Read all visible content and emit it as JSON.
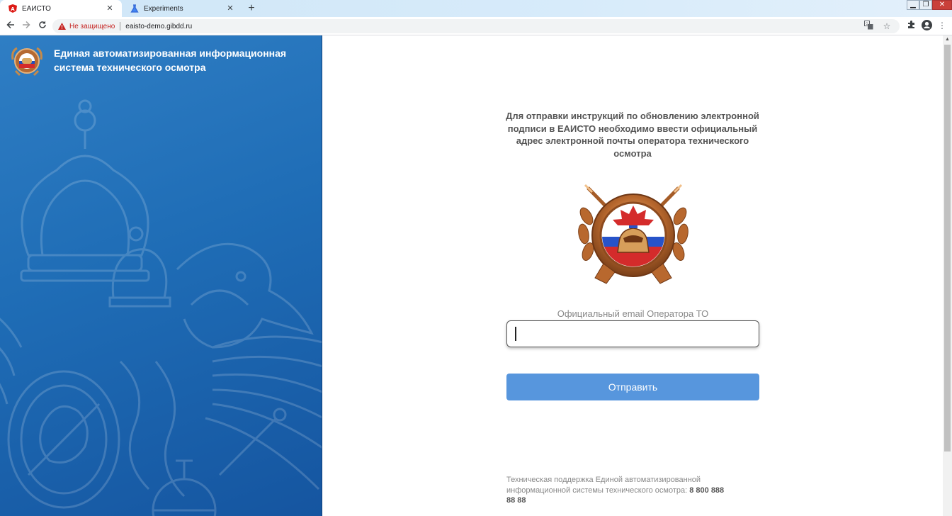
{
  "browser": {
    "tabs": [
      {
        "title": "ЕАИСТО",
        "active": true
      },
      {
        "title": "Experiments",
        "active": false
      }
    ],
    "new_tab": "+",
    "security_warning": "Не защищено",
    "url": "eaisto-demo.gibdd.ru"
  },
  "header": {
    "system_title": "Единая автоматизированная информационная система технического осмотра"
  },
  "form": {
    "instructions": "Для отправки инструкций по обновлению электронной подписи в ЕАИСТО необходимо ввести официальный адрес электронной почты оператора технического осмотра",
    "email_label": "Официальный email Оператора ТО",
    "email_value": "",
    "submit_label": "Отправить"
  },
  "footer": {
    "support_text": "Техническая поддержка Единой автоматизированной информационной системы технического осмотра:",
    "support_phone": "8 800 888 88 88"
  },
  "colors": {
    "panel_blue": "#1f6db6",
    "button_blue": "#5796dd",
    "warning_red": "#c5221f"
  }
}
